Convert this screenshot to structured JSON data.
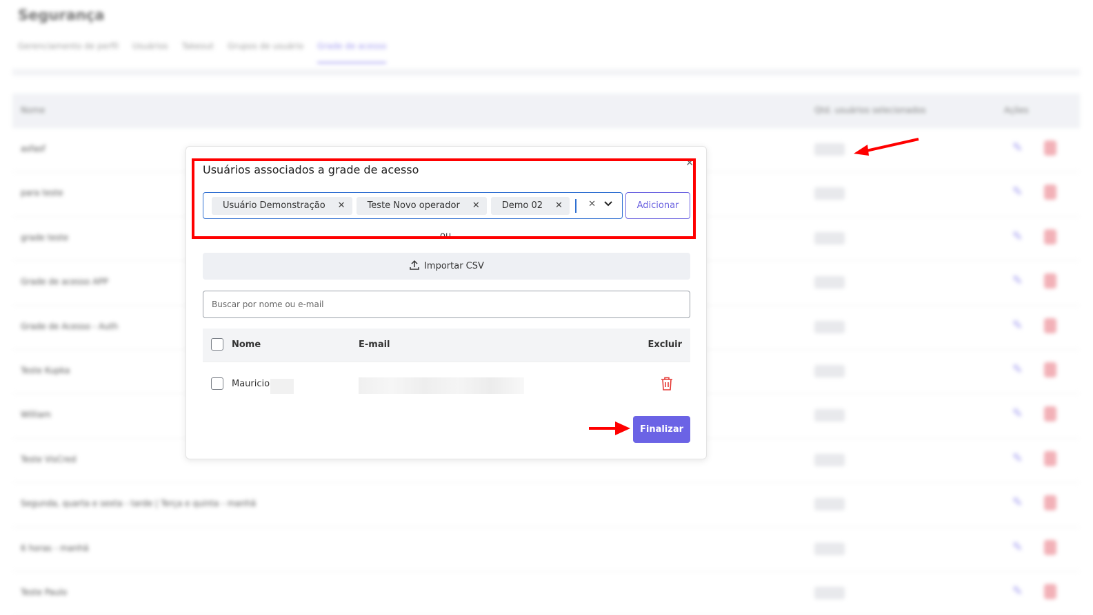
{
  "background": {
    "title": "Segurança",
    "tabs": [
      {
        "label": "Gerenciamento de perfil"
      },
      {
        "label": "Usuários"
      },
      {
        "label": "Takeout"
      },
      {
        "label": "Grupos de usuário"
      },
      {
        "label": "Grade de acesso"
      }
    ],
    "table": {
      "col_name": "Nome",
      "col_users": "Qtd. usuários selecionados",
      "col_actions": "Ações",
      "rows": [
        {
          "name": "asfasf"
        },
        {
          "name": "para teste"
        },
        {
          "name": "grade teste"
        },
        {
          "name": "Grade de acesso APP"
        },
        {
          "name": "Grade de Acesso - Auth"
        },
        {
          "name": "Teste Kupka"
        },
        {
          "name": "William"
        },
        {
          "name": "Teste VisCred"
        },
        {
          "name": "Segunda, quarta e sexta - tarde | Terça e quinta - manhã"
        },
        {
          "name": "6 horas - manhã"
        },
        {
          "name": "Teste Paulo"
        }
      ]
    }
  },
  "modal": {
    "title": "Usuários associados a grade de acesso",
    "selected_users": [
      {
        "label": "Usuário Demonstração"
      },
      {
        "label": "Teste Novo operador"
      },
      {
        "label": "Demo 02"
      }
    ],
    "add_label": "Adicionar",
    "or_label": "ou",
    "import_label": "Importar CSV",
    "search_placeholder": "Buscar por nome ou e-mail",
    "table": {
      "col_name": "Nome",
      "col_email": "E-mail",
      "col_delete": "Excluir",
      "rows": [
        {
          "name": "Mauricio"
        }
      ]
    },
    "finish_label": "Finalizar"
  },
  "colors": {
    "accent": "#6b63e5",
    "annotation": "#ff0000",
    "danger": "#e53935"
  }
}
